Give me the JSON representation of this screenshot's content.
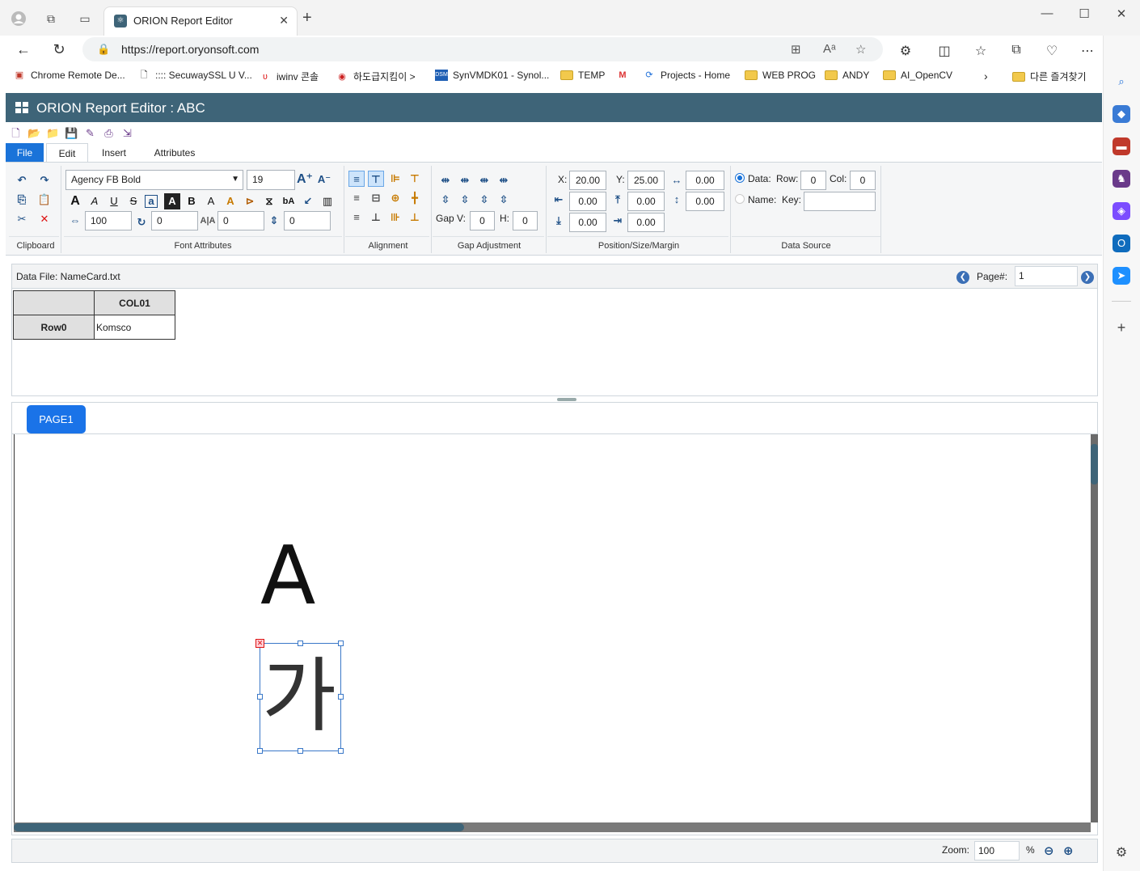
{
  "browser": {
    "tab_title": "ORION Report Editor",
    "url": "https://report.oryonsoft.com",
    "bookmarks": [
      "Chrome Remote De...",
      ":::: SecuwaySSL U V...",
      "iwinv 콘솔",
      "하도급지킴이 >",
      "SynVMDK01 - Synol...",
      "TEMP",
      "Projects - Home",
      "WEB PROG",
      "ANDY",
      "AI_OpenCV",
      "다른 즐겨찾기"
    ]
  },
  "app": {
    "title": "ORION Report Editor : ABC"
  },
  "ribbon": {
    "tabs": [
      "File",
      "Edit",
      "Insert",
      "Attributes"
    ],
    "font_name": "Agency FB Bold",
    "font_size": "19",
    "scale": "100",
    "rotation": "0",
    "char_spacing": "0",
    "line_spacing": "0",
    "gap_v_label": "Gap V:",
    "gap_v": "0",
    "gap_h_label": "H:",
    "gap_h": "0",
    "x_label": "X:",
    "x": "20.00",
    "y_label": "Y:",
    "y": "25.00",
    "width": "0.00",
    "margin_left": "0.00",
    "margin_top": "0.00",
    "height": "0.00",
    "margin_bottom": "0.00",
    "margin_right": "0.00",
    "data_label": "Data:",
    "row_label": "Row:",
    "row": "0",
    "col_label": "Col:",
    "col": "0",
    "name_label": "Name:",
    "key_label": "Key:",
    "key": "",
    "groups": [
      "Clipboard",
      "Font Attributes",
      "Alignment",
      "Gap Adjustment",
      "Position/Size/Margin",
      "Data Source"
    ]
  },
  "data_panel": {
    "file_label": "Data File: NameCard.txt",
    "page_label": "Page#:",
    "page_value": "1",
    "columns": [
      "",
      "COL01"
    ],
    "rows": [
      [
        "Row0",
        "Komsco"
      ]
    ]
  },
  "design": {
    "page_tab": "PAGE1",
    "text_a": "A",
    "text_ga": "가"
  },
  "status": {
    "zoom_label": "Zoom:",
    "zoom_value": "100",
    "zoom_unit": "%"
  },
  "colors": {
    "title_bar": "#3e6478",
    "accent": "#1a73e8",
    "file_tab": "#1a73d9"
  }
}
